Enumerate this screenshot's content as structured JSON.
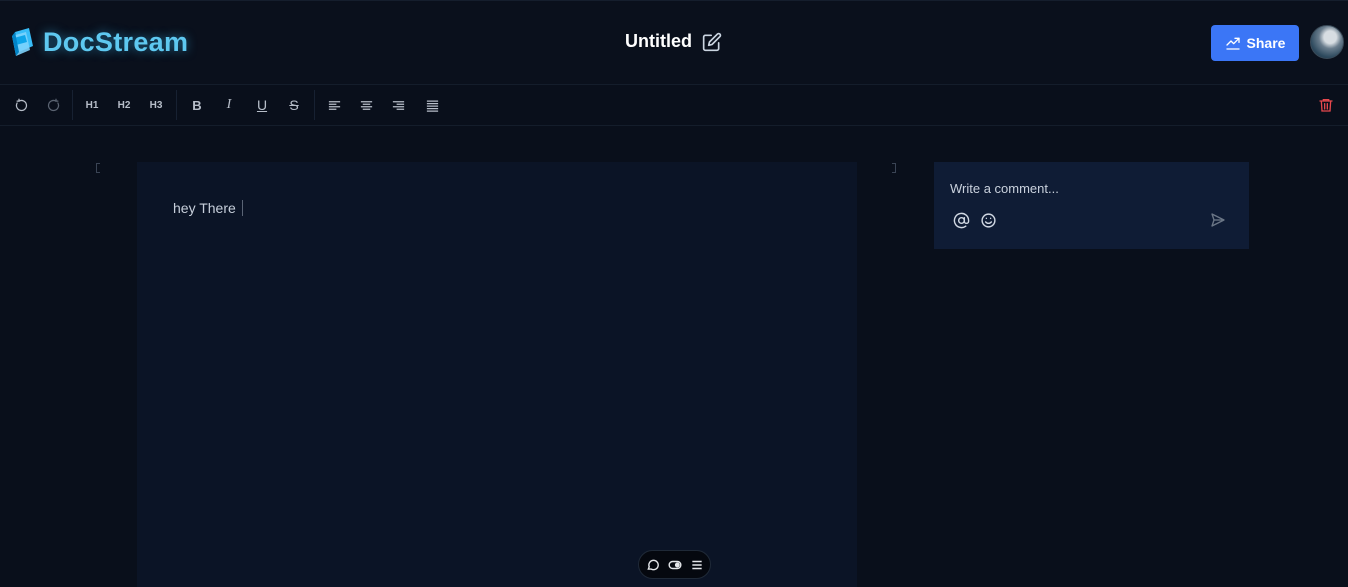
{
  "app": {
    "name": "DocStream"
  },
  "document": {
    "title": "Untitled",
    "content": "hey There"
  },
  "header": {
    "share_label": "Share"
  },
  "toolbar": {
    "undo_icon": "undo-icon",
    "redo_icon": "redo-icon",
    "h1_label": "H1",
    "h2_label": "H2",
    "h3_label": "H3",
    "bold_label": "B",
    "italic_label": "I",
    "underline_label": "U",
    "strike_label": "S",
    "delete_icon": "trash-icon"
  },
  "comments": {
    "placeholder": "Write a comment..."
  },
  "colors": {
    "background": "#090f1b",
    "brand": "#5ec8f0",
    "accent": "#3b76f6",
    "danger": "#e5484d",
    "editor_bg": "#0b1426",
    "comment_bg": "#0f1c35"
  }
}
